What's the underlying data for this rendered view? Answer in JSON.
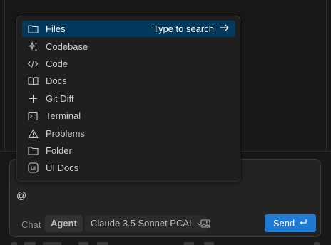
{
  "mention_menu": {
    "items": [
      {
        "label": "Files",
        "icon": "folder-icon",
        "selected": true
      },
      {
        "label": "Codebase",
        "icon": "sparkles-icon"
      },
      {
        "label": "Code",
        "icon": "code-brackets-icon"
      },
      {
        "label": "Docs",
        "icon": "book-icon"
      },
      {
        "label": "Git Diff",
        "icon": "plus-icon"
      },
      {
        "label": "Terminal",
        "icon": "terminal-icon"
      },
      {
        "label": "Problems",
        "icon": "warning-icon"
      },
      {
        "label": "Folder",
        "icon": "folder-icon"
      },
      {
        "label": "UI Docs",
        "icon": "ui-badge-icon",
        "badge_text": "UI"
      }
    ],
    "selected_hint": "Type to search"
  },
  "composer": {
    "input_value": "@",
    "mode_chat": "Chat",
    "mode_agent": "Agent",
    "model_name": "Claude 3.5 Sonnet PCAI",
    "send_label": "Send"
  },
  "colors": {
    "background": "#181818",
    "popup_background": "#1f1f1f",
    "selected_item": "#04395e",
    "send_button": "#1f7ad4"
  }
}
